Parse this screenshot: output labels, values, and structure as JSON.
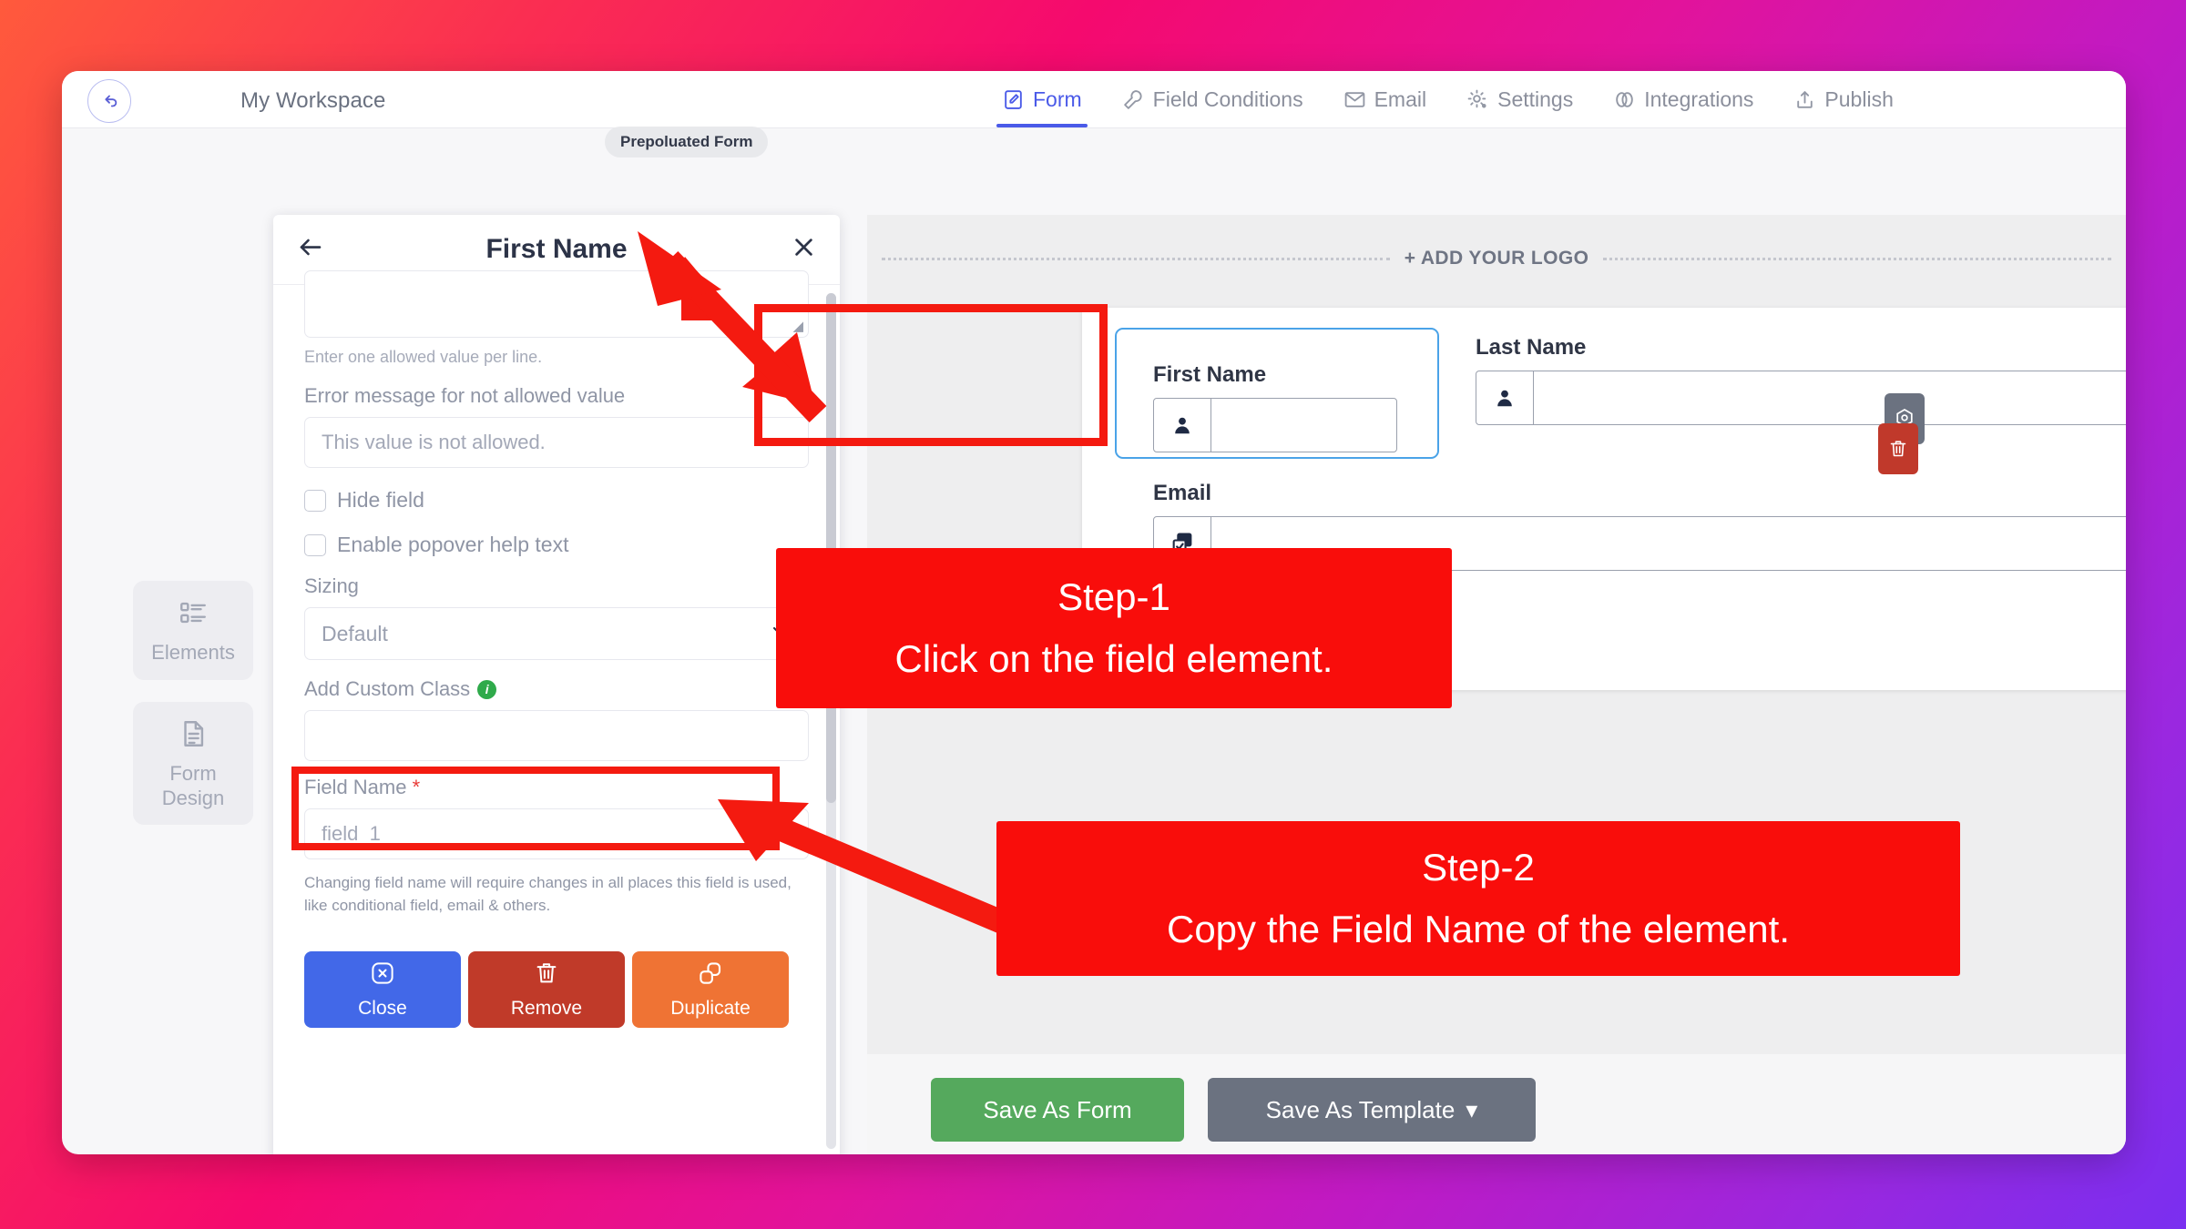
{
  "header": {
    "back_icon": "undo-arrow-icon",
    "workspace_title": "My Workspace",
    "form_badge": "Prepoluated Form",
    "tabs": [
      {
        "label": "Form",
        "icon": "document-pencil-icon",
        "active": true
      },
      {
        "label": "Field Conditions",
        "icon": "wrench-icon",
        "active": false
      },
      {
        "label": "Email",
        "icon": "envelope-icon",
        "active": false
      },
      {
        "label": "Settings",
        "icon": "gear-icon",
        "active": false
      },
      {
        "label": "Integrations",
        "icon": "link-rings-icon",
        "active": false
      },
      {
        "label": "Publish",
        "icon": "upload-icon",
        "active": false
      }
    ]
  },
  "rail": {
    "items": [
      {
        "label": "Elements",
        "icon": "list-blocks-icon"
      },
      {
        "label": "Form Design",
        "icon": "document-lines-icon"
      }
    ]
  },
  "panel": {
    "back_icon": "arrow-left-icon",
    "title": "First Name",
    "close_icon": "close-x-icon",
    "allowed_values_hint": "Enter one allowed value per line.",
    "error_message_label": "Error message for not allowed value",
    "error_message_value": "This value is not allowed.",
    "hide_field_label": "Hide field",
    "popover_label": "Enable popover help text",
    "sizing_label": "Sizing",
    "sizing_value": "Default",
    "custom_class_label": "Add Custom Class",
    "custom_class_info_icon": "info-icon",
    "custom_class_value": "",
    "field_name_label": "Field Name",
    "field_name_required_mark": "*",
    "field_name_value": "field_1",
    "field_name_note": "Changing field name will require changes in all places this field is used, like conditional field, email & others.",
    "buttons": [
      {
        "label": "Close",
        "icon": "close-circle-icon",
        "color": "#4268e8"
      },
      {
        "label": "Remove",
        "icon": "trash-icon",
        "color": "#c03a29"
      },
      {
        "label": "Duplicate",
        "icon": "duplicate-icon",
        "color": "#ef7334"
      }
    ]
  },
  "preview": {
    "add_logo_label": "+ ADD YOUR LOGO",
    "fields": [
      {
        "label": "First Name",
        "icon": "person-icon",
        "value": ""
      },
      {
        "label": "Last Name",
        "icon": "person-icon",
        "value": ""
      },
      {
        "label": "Email",
        "icon": "forms-stack-icon",
        "value": ""
      }
    ],
    "hover_tools": [
      {
        "name": "gear-icon",
        "color": "#6b7280"
      },
      {
        "name": "trash-icon",
        "color": "#c0392b"
      }
    ]
  },
  "annotations": [
    {
      "title": "Step-1",
      "text": "Click on the field element."
    },
    {
      "title": "Step-2",
      "text": "Copy the Field Name of the element."
    }
  ],
  "footer": {
    "save_form_label": "Save As Form",
    "save_template_label": "Save As Template",
    "save_template_caret": "▾"
  },
  "colors": {
    "accent": "#4a5ae8",
    "annotation_red": "#f90d0b",
    "selection_blue": "#4aa3e8",
    "save_green": "#55a95d",
    "grey": "#6b7280"
  }
}
